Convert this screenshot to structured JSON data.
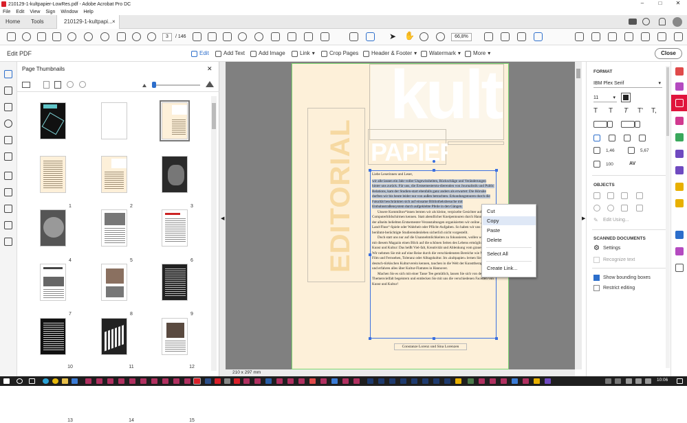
{
  "window": {
    "title": "210129-1-kultpapier-LowRes.pdf - Adobe Acrobat Pro DC",
    "minimize": "–",
    "maximize": "□",
    "close": "✕"
  },
  "menu": [
    "File",
    "Edit",
    "View",
    "Sign",
    "Window",
    "Help"
  ],
  "tabs": {
    "home": "Home",
    "tools": "Tools",
    "doc": "210129-1-kultpapi...",
    "doc_close": "×"
  },
  "toolbar": {
    "page_current": "3",
    "page_total": "/ 146",
    "zoom": "66,8%"
  },
  "editbar": {
    "title": "Edit PDF",
    "edit": "Edit",
    "add_text": "Add Text",
    "add_image": "Add Image",
    "link": "Link",
    "crop": "Crop Pages",
    "header_footer": "Header & Footer",
    "watermark": "Watermark",
    "more": "More",
    "close": "Close"
  },
  "thumbs": {
    "title": "Page Thumbnails",
    "close": "✕",
    "pages": [
      "1",
      "2",
      "3",
      "4",
      "5",
      "6",
      "7",
      "8",
      "9",
      "10",
      "11",
      "12",
      "13",
      "14",
      "15"
    ]
  },
  "document": {
    "kult": "kult",
    "papier": "PAPIER",
    "editorial": "EDITORIAL",
    "salutation": "Liebe Leserinnen und Leser,",
    "para1_sel": "wir alle lassen ein Jahr voller Ungewissheiten, Rückschläge und Veränderungen hinter uns zurück. Für uns, die Erstsemesterstu-dierenden von Journalistik und Public Relations, kam der Studien-start ebenfalls ganz anders als erwartet: Die Hörsäle durften wir bis heute leider nur von außen betrachten. Erkundungstouren durch die Fakultät beschränkten sich auf einsame Bibliotheksbesuche mit Einbahnstraßensystem durch aufgeklebte Pfeile in den Gängen.",
    "para2": "Unsere Kommilton*innen lernten wir als kleine, verpixelte Gesichter auf unseren Computerbildschirmen kennen. Statt abendlicher Kneipentouren durch Hannover und der allseits beliebten Erstsemester-Veranstaltungen organisierten wir online „Stadt-Land-Fluss“-Spiele oder Wahrheit oder Pflicht-Aufgaben. So haben wir uns das berühmt-berüchtigte Studierendenleben sicherlich nicht vorgestellt.",
    "para3": "Doch statt uns nur auf die Unannehmlichkeiten zu fokussieren, wollen wir Ihnen mit diesem Magazin einen Blick auf die schönen Seiten des Lebens ermöglichen. Kunst und Kultur: Das heißt Viel-falt, Kreativität und Ablenkung vom grauen Alltag. Wir nehmen Sie mit auf eine Reise durch die verschiedensten Bereiche wie Musik, Film und Fernsehen, Toleranz oder Alltagskultur. Im »kultpapier« lernen Sie den deutsch-türkischen Kulturverein kennen, tauchen in die Welt der Kunsttherapie ein und erfahren alles über Kultur-Flatrates in Hannover.",
    "para4": "Machen Sie es sich mit einer Tasse Tee gemütlich, lassen Sie sich von der Themenvielfalt begeistern und entdecken Sie mit uns die verschiedenen Facetten von Kunst und Kultur!",
    "signature": "Constanze Lorenz und Sina Lorenzen",
    "page_size": "210 x 297 mm"
  },
  "context_menu": [
    "Cut",
    "Copy",
    "Paste",
    "Delete",
    "Select All",
    "Create Link..."
  ],
  "right_panel": {
    "format": "FORMAT",
    "font": "IBM Plex Serif",
    "font_size": "11",
    "line_spacing": "1,46",
    "char_spacing": "5,67",
    "scale": "100",
    "objects": "OBJECTS",
    "edit_using": "Edit Using...",
    "scanned": "SCANNED DOCUMENTS",
    "settings": "Settings",
    "recognize": "Recognize text",
    "show_bbox": "Show bounding boxes",
    "restrict": "Restrict editing"
  },
  "taskbar": {
    "time": "10:06"
  },
  "colors": {
    "accent": "#e0143c",
    "selection": "#3a6fe0",
    "page_bg": "#fdf0d9"
  }
}
